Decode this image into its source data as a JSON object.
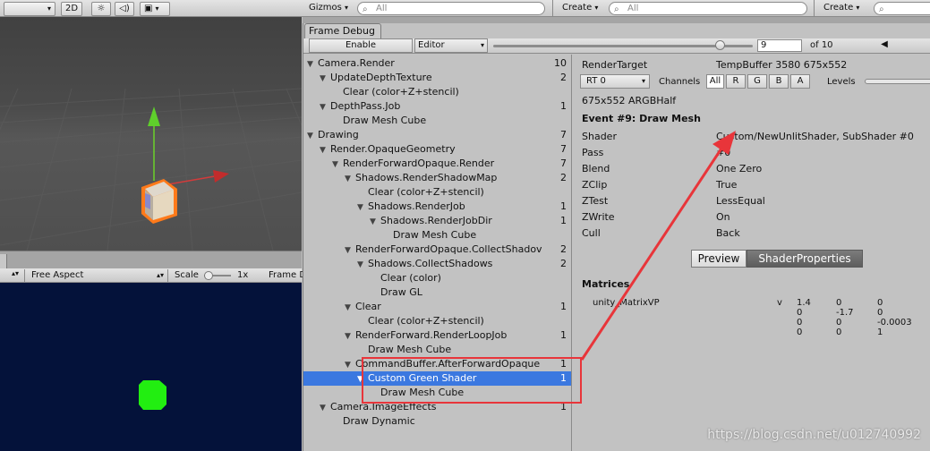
{
  "top_toolbar": {
    "mode_2d": "2D",
    "gizmos": "Gizmos",
    "gizmos_search_placeholder": "All",
    "create_left": "Create",
    "search_left_placeholder": "All",
    "create_right": "Create"
  },
  "game_toolbar": {
    "aspect": "Free Aspect",
    "scale_label": "Scale",
    "scale_value": "1x",
    "frame_label": "Frame D"
  },
  "frame_debug": {
    "tab_title": "Frame Debug",
    "enable_label": "Enable",
    "editor_label": "Editor",
    "frame_index": "9",
    "frame_total": "of 10",
    "slider_fraction": 0.87
  },
  "tree": [
    {
      "label": "Camera.Render",
      "count": "10",
      "indent": 0,
      "expanded": true
    },
    {
      "label": "UpdateDepthTexture",
      "count": "2",
      "indent": 1,
      "expanded": true
    },
    {
      "label": "Clear (color+Z+stencil)",
      "count": "",
      "indent": 2,
      "expanded": null
    },
    {
      "label": "DepthPass.Job",
      "count": "1",
      "indent": 1,
      "expanded": true
    },
    {
      "label": "Draw Mesh Cube",
      "count": "",
      "indent": 2,
      "expanded": null
    },
    {
      "label": "Drawing",
      "count": "7",
      "indent": 0,
      "expanded": true
    },
    {
      "label": "Render.OpaqueGeometry",
      "count": "7",
      "indent": 1,
      "expanded": true
    },
    {
      "label": "RenderForwardOpaque.Render",
      "count": "7",
      "indent": 2,
      "expanded": true
    },
    {
      "label": "Shadows.RenderShadowMap",
      "count": "2",
      "indent": 3,
      "expanded": true
    },
    {
      "label": "Clear (color+Z+stencil)",
      "count": "",
      "indent": 4,
      "expanded": null
    },
    {
      "label": "Shadows.RenderJob",
      "count": "1",
      "indent": 4,
      "expanded": true
    },
    {
      "label": "Shadows.RenderJobDir",
      "count": "1",
      "indent": 5,
      "expanded": true
    },
    {
      "label": "Draw Mesh Cube",
      "count": "",
      "indent": 6,
      "expanded": null
    },
    {
      "label": "RenderForwardOpaque.CollectShadov",
      "count": "2",
      "indent": 3,
      "expanded": true
    },
    {
      "label": "Shadows.CollectShadows",
      "count": "2",
      "indent": 4,
      "expanded": true
    },
    {
      "label": "Clear (color)",
      "count": "",
      "indent": 5,
      "expanded": null
    },
    {
      "label": "Draw GL",
      "count": "",
      "indent": 5,
      "expanded": null
    },
    {
      "label": "Clear",
      "count": "1",
      "indent": 3,
      "expanded": true
    },
    {
      "label": "Clear (color+Z+stencil)",
      "count": "",
      "indent": 4,
      "expanded": null
    },
    {
      "label": "RenderForward.RenderLoopJob",
      "count": "1",
      "indent": 3,
      "expanded": true
    },
    {
      "label": "Draw Mesh Cube",
      "count": "",
      "indent": 4,
      "expanded": null
    },
    {
      "label": "CommandBuffer.AfterForwardOpaque",
      "count": "1",
      "indent": 3,
      "expanded": true
    },
    {
      "label": "Custom Green Shader",
      "count": "1",
      "indent": 4,
      "expanded": true,
      "selected": true
    },
    {
      "label": "Draw Mesh Cube",
      "count": "",
      "indent": 5,
      "expanded": null
    },
    {
      "label": "Camera.ImageEffects",
      "count": "1",
      "indent": 1,
      "expanded": true
    },
    {
      "label": "Draw Dynamic",
      "count": "",
      "indent": 2,
      "expanded": null
    }
  ],
  "details": {
    "render_target_label": "RenderTarget",
    "render_target_value": "TempBuffer 3580 675x552",
    "rt_select": "RT 0",
    "channels_label": "Channels",
    "channels": [
      "All",
      "R",
      "G",
      "B",
      "A"
    ],
    "levels_label": "Levels",
    "format": "675x552 ARGBHalf",
    "event_title": "Event #9: Draw Mesh",
    "props": [
      {
        "name": "Shader",
        "value": "Custom/NewUnlitShader, SubShader #0"
      },
      {
        "name": "Pass",
        "value": "#0"
      },
      {
        "name": "Blend",
        "value": "One Zero"
      },
      {
        "name": "ZClip",
        "value": "True"
      },
      {
        "name": "ZTest",
        "value": "LessEqual"
      },
      {
        "name": "ZWrite",
        "value": "On"
      },
      {
        "name": "Cull",
        "value": "Back"
      }
    ],
    "tab_preview": "Preview",
    "tab_shader_properties": "ShaderProperties",
    "matrices_title": "Matrices",
    "matrix_name": "unity_MatrixVP",
    "matrix_type": "v",
    "matrix_rows": [
      [
        "1.4",
        "0",
        "0"
      ],
      [
        "0",
        "-1.7",
        "0"
      ],
      [
        "0",
        "0",
        "-0.0003"
      ],
      [
        "0",
        "0",
        "1"
      ]
    ]
  },
  "watermark": "https://blog.csdn.net/u012740992",
  "colors": {
    "selection": "#3b78e0",
    "annotation_red": "#e8353a",
    "game_background": "#04123a",
    "green_object": "#22ee11"
  }
}
